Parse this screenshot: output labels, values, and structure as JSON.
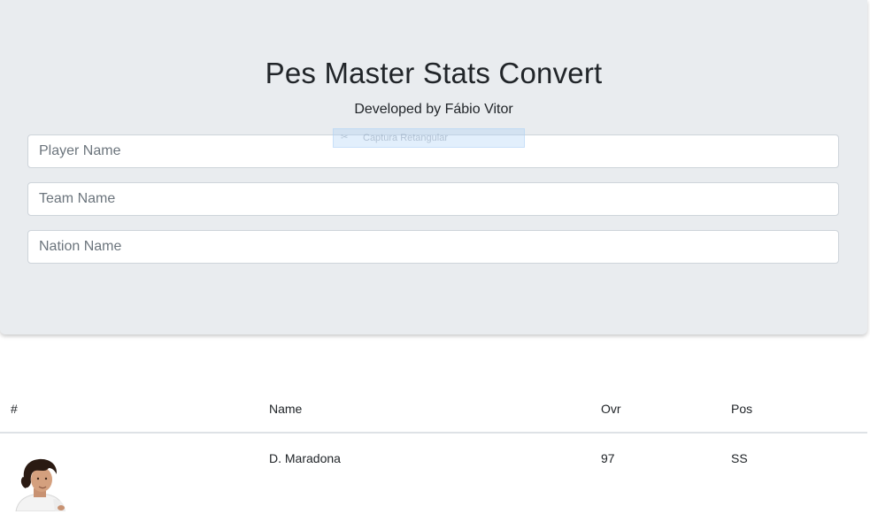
{
  "header": {
    "title": "Pes Master Stats Convert",
    "subtitle": "Developed by Fábio Vitor"
  },
  "overlay": {
    "capture_label": "Captura Retangular",
    "capture_icon": "scissors-icon"
  },
  "search": {
    "player_placeholder": "Player Name",
    "team_placeholder": "Team Name",
    "nation_placeholder": "Nation Name"
  },
  "table": {
    "headers": [
      "#",
      "Name",
      "Ovr",
      "Pos"
    ],
    "rows": [
      {
        "photo": "player-photo",
        "name": "D. Maradona",
        "ovr": "97",
        "pos": "SS"
      }
    ]
  },
  "colors": {
    "jumbotron_bg": "#e9ecef",
    "text": "#212529",
    "border": "#ced4da"
  }
}
